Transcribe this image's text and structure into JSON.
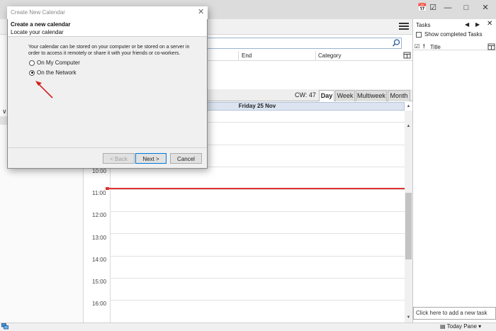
{
  "dialog": {
    "window_title": "Create New Calendar",
    "heading": "Create a new calendar",
    "subheading": "Locate your calendar",
    "description": "Your calendar can be stored on your computer or be stored on a server in order to access it remotely or share it with your friends or co-workers.",
    "options": [
      {
        "label": "On My Computer",
        "selected": false
      },
      {
        "label": "On the Network",
        "selected": true
      }
    ],
    "buttons": {
      "back": "< Back",
      "next": "Next >",
      "cancel": "Cancel"
    }
  },
  "event_list": {
    "columns": [
      "End",
      "Category"
    ]
  },
  "views": {
    "cw_label": "CW: 47",
    "tabs": [
      "Day",
      "Week",
      "Multiweek",
      "Month"
    ],
    "active_tab": "Day"
  },
  "day_view": {
    "date_header": "Friday 25 Nov",
    "hours": [
      "10:00",
      "11:00",
      "12:00",
      "13:00",
      "14:00",
      "15:00",
      "16:00"
    ]
  },
  "tasks": {
    "title": "Tasks",
    "show_completed_label": "Show completed Tasks",
    "priority_symbol": "!",
    "title_column": "Title",
    "add_task_placeholder": "Click here to add a new task"
  },
  "statusbar": {
    "today_pane_label": "Today Pane"
  },
  "colors": {
    "now_indicator": "#dd3333",
    "annotation_arrow": "#d62020",
    "day_header_bg": "#dbe4f0"
  }
}
